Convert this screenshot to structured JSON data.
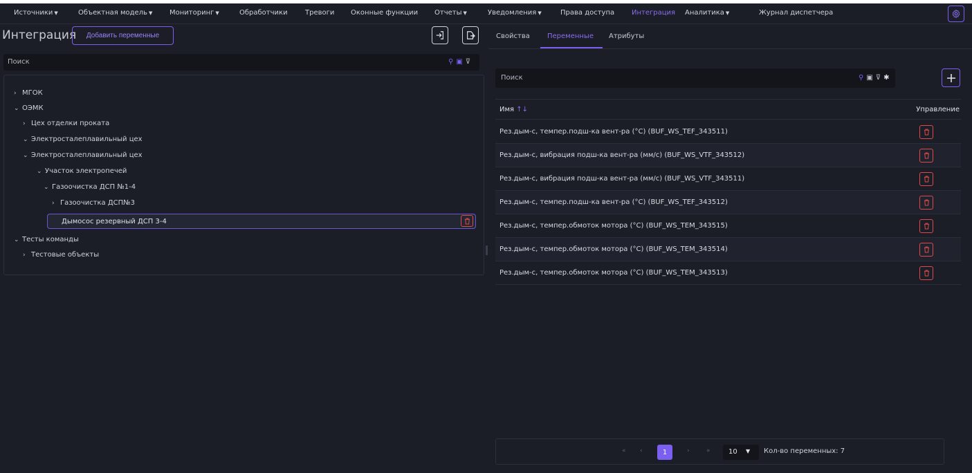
{
  "colors": {
    "accent": "#7b5ff0",
    "danger": "#e04a4a",
    "background": "#1b1e27"
  },
  "nav": {
    "items": [
      {
        "label": "Источники",
        "dropdown": true
      },
      {
        "label": "Объектная модель",
        "dropdown": true
      },
      {
        "label": "Мониторинг",
        "dropdown": true
      },
      {
        "label": "Обработчики",
        "dropdown": false
      },
      {
        "label": "Тревоги",
        "dropdown": false
      },
      {
        "label": "Оконные функции",
        "dropdown": false
      },
      {
        "label": "Отчеты",
        "dropdown": true
      },
      {
        "label": "Уведомления",
        "dropdown": true
      },
      {
        "label": "Права доступа",
        "dropdown": false
      },
      {
        "label": "Интеграция",
        "dropdown": false,
        "active": true
      },
      {
        "label": "Аналитика",
        "dropdown": true
      },
      {
        "label": "Журнал диспетчера",
        "dropdown": false
      }
    ],
    "settings_icon": "gear-icon"
  },
  "left": {
    "title": "Интеграция",
    "add_vars_label": "Добавить переменные",
    "import_icon": "import-icon",
    "export_icon": "export-icon",
    "search_placeholder": "Поиск",
    "tree": [
      {
        "label": "МГОК",
        "expanded": false
      },
      {
        "label": "ОЭМК",
        "expanded": true
      },
      {
        "label": "Цех отделки проката",
        "expanded": false
      },
      {
        "label": "Электросталеплавильный цех",
        "expanded": true
      },
      {
        "label": "Электросталеплавильный цех",
        "expanded": true
      },
      {
        "label": "Участок электропечей",
        "expanded": true
      },
      {
        "label": "Газоочистка ДСП №1-4",
        "expanded": true
      },
      {
        "label": "Газоочистка ДСП№3",
        "expanded": false
      },
      {
        "label": "Дымосос резервный ДСП 3-4",
        "selected": true
      },
      {
        "label": "Тесты команды",
        "expanded": true
      },
      {
        "label": "Тестовые объекты",
        "expanded": false
      }
    ]
  },
  "right": {
    "tabs": [
      {
        "label": "Свойства"
      },
      {
        "label": "Переменные",
        "active": true
      },
      {
        "label": "Атрибуты"
      }
    ],
    "search_placeholder": "Поиск",
    "table": {
      "col_name": "Имя",
      "sort_icon": "sort-icon",
      "col_control": "Управление",
      "rows": [
        "Рез.дым-с, темпер.подш-ка вент-ра (°С) (BUF_WS_TEF_343511)",
        "Рез.дым-с, вибрация подш-ка вент-ра (мм/с) (BUF_WS_VTF_343512)",
        "Рез.дым-с, вибрация подш-ка вент-ра (мм/с) (BUF_WS_VTF_343511)",
        "Рез.дым-с, темпер.подш-ка вент-ра (°С) (BUF_WS_TEF_343512)",
        "Рез.дым-с, темпер.обмоток мотора (°С) (BUF_WS_TEM_343515)",
        "Рез.дым-с, темпер.обмоток мотора (°С) (BUF_WS_TEM_343514)",
        "Рез.дым-с, темпер.обмоток мотора (°С) (BUF_WS_TEM_343513)"
      ]
    },
    "pager": {
      "first": "«",
      "prev": "‹",
      "current_page": "1",
      "next": "›",
      "last": "»",
      "page_size": "10",
      "count_label": "Кол-во переменных: 7"
    }
  }
}
